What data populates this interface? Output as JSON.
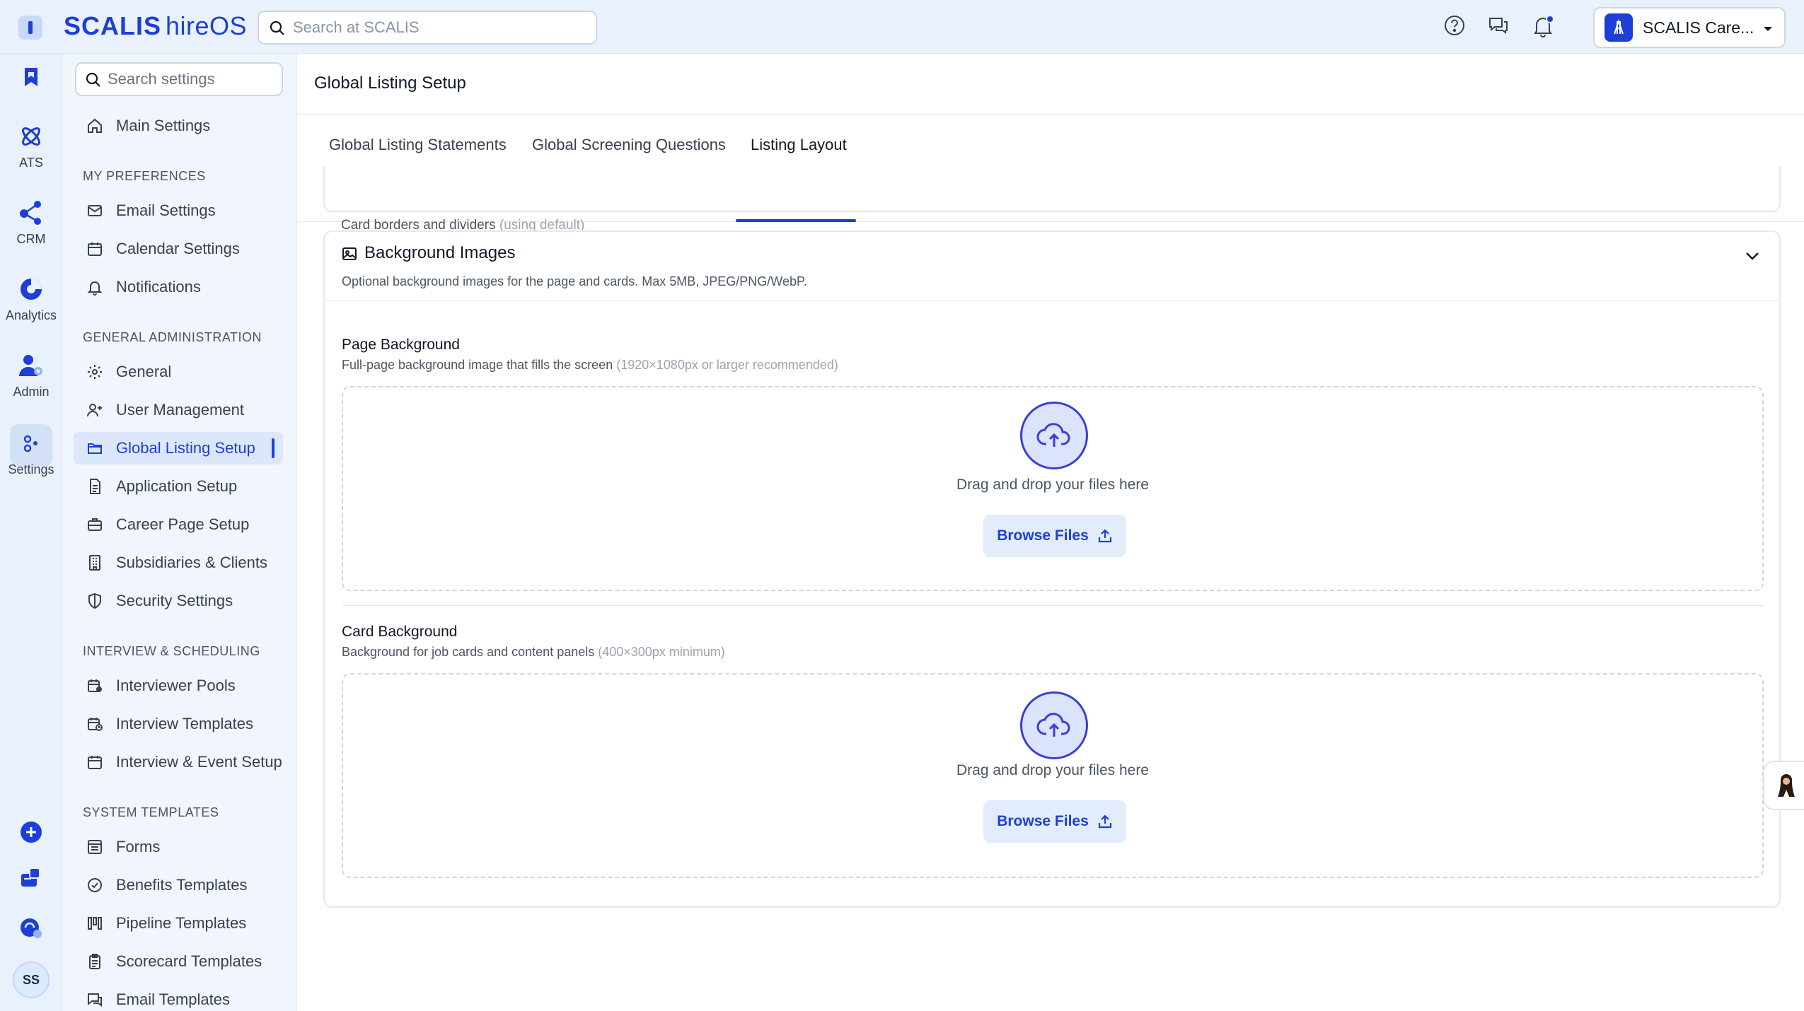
{
  "brand": {
    "name_bold": "SCALIS",
    "name_light": "hireOS"
  },
  "top_search": {
    "placeholder": "Search at SCALIS"
  },
  "org": {
    "name": "SCALIS Care..."
  },
  "rail": {
    "items": [
      {
        "label": "ATS",
        "icon": "atom-icon"
      },
      {
        "label": "CRM",
        "icon": "network-icon"
      },
      {
        "label": "Analytics",
        "icon": "pie-chart-icon"
      },
      {
        "label": "Admin",
        "icon": "user-gear-icon"
      },
      {
        "label": "Settings",
        "icon": "settings-dots-icon"
      }
    ],
    "avatar_initials": "SS"
  },
  "sidebar": {
    "search_placeholder": "Search settings",
    "main_settings": "Main Settings",
    "sections": [
      {
        "title": "MY PREFERENCES",
        "items": [
          "Email Settings",
          "Calendar Settings",
          "Notifications"
        ]
      },
      {
        "title": "GENERAL ADMINISTRATION",
        "items": [
          "General",
          "User Management",
          "Global Listing Setup",
          "Application Setup",
          "Career Page Setup",
          "Subsidiaries & Clients",
          "Security Settings"
        ]
      },
      {
        "title": "INTERVIEW & SCHEDULING",
        "items": [
          "Interviewer Pools",
          "Interview Templates",
          "Interview & Event Setup"
        ]
      },
      {
        "title": "SYSTEM TEMPLATES",
        "items": [
          "Forms",
          "Benefits Templates",
          "Pipeline Templates",
          "Scorecard Templates",
          "Email Templates"
        ]
      }
    ],
    "active_item": "Global Listing Setup"
  },
  "main": {
    "title": "Global Listing Setup",
    "tabs": [
      "Global Listing Statements",
      "Global Screening Questions",
      "Listing Layout"
    ],
    "active_tab": "Listing Layout",
    "prev_card": {
      "text": "Card borders and dividers",
      "note": "(using default)"
    },
    "card": {
      "title": "Background Images",
      "description": "Optional background images for the page and cards. Max 5MB, JPEG/PNG/WebP.",
      "sections": [
        {
          "label": "Page Background",
          "desc": "Full-page background image that fills the screen",
          "note": "(1920×1080px or larger recommended)",
          "drop_text": "Drag and drop your files here",
          "button": "Browse Files"
        },
        {
          "label": "Card Background",
          "desc": "Background for job cards and content panels",
          "note": "(400×300px minimum)",
          "drop_text": "Drag and drop your files here",
          "button": "Browse Files"
        }
      ]
    }
  },
  "colors": {
    "accent": "#1d3fd6",
    "rail_bg": "#e9f1fd",
    "sidebar_bg": "#f1f5fc",
    "active_bg": "#dce7fb"
  }
}
